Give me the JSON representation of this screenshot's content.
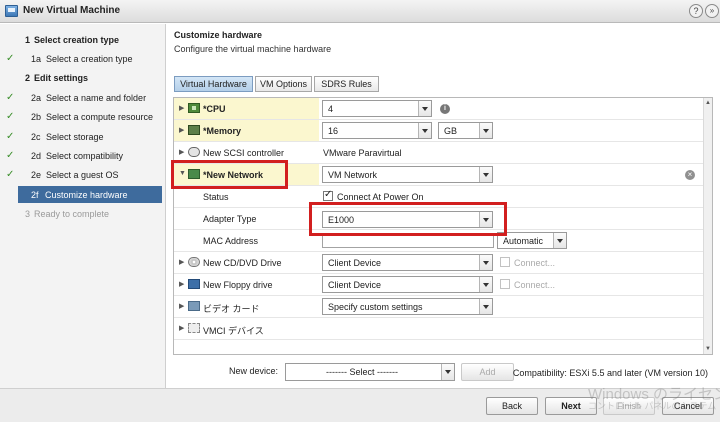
{
  "window": {
    "title": "New Virtual Machine",
    "help_label": "?",
    "expand_label": "»"
  },
  "wizard_steps": [
    {
      "num": "1",
      "label": "Select creation type",
      "kind": "header",
      "done": false
    },
    {
      "num": "1a",
      "label": "Select a creation type",
      "kind": "sub",
      "done": true
    },
    {
      "num": "2",
      "label": "Edit settings",
      "kind": "header",
      "done": false
    },
    {
      "num": "2a",
      "label": "Select a name and folder",
      "kind": "sub",
      "done": true
    },
    {
      "num": "2b",
      "label": "Select a compute resource",
      "kind": "sub",
      "done": true
    },
    {
      "num": "2c",
      "label": "Select storage",
      "kind": "sub",
      "done": true
    },
    {
      "num": "2d",
      "label": "Select compatibility",
      "kind": "sub",
      "done": true
    },
    {
      "num": "2e",
      "label": "Select a guest OS",
      "kind": "sub",
      "done": true
    },
    {
      "num": "2f",
      "label": "Customize hardware",
      "kind": "active",
      "done": false
    },
    {
      "num": "3",
      "label": "Ready to complete",
      "kind": "disabled",
      "done": false
    }
  ],
  "check_glyph": "✓",
  "main": {
    "title": "Customize hardware",
    "subtitle": "Configure the virtual machine hardware"
  },
  "tabs": [
    "Virtual Hardware",
    "VM Options",
    "SDRS Rules"
  ],
  "hardware": {
    "cpu": {
      "label": "*CPU",
      "value": "4"
    },
    "memory": {
      "label": "*Memory",
      "value": "16",
      "unit": "GB"
    },
    "scsi": {
      "label": "New SCSI controller",
      "value": "VMware Paravirtual"
    },
    "network": {
      "label": "*New Network",
      "value": "VM Network"
    },
    "status": {
      "label": "Status",
      "value": "Connect At Power On"
    },
    "adapter": {
      "label": "Adapter Type",
      "value": "E1000"
    },
    "mac": {
      "label": "MAC Address",
      "value": "",
      "mode": "Automatic"
    },
    "cd": {
      "label": "New CD/DVD Drive",
      "value": "Client Device",
      "connect": "Connect..."
    },
    "floppy": {
      "label": "New Floppy drive",
      "value": "Client Device",
      "connect": "Connect..."
    },
    "video": {
      "label": "ビデオ カード",
      "value": "Specify custom settings"
    },
    "vmci": {
      "label": "VMCI デバイス"
    }
  },
  "new_device": {
    "label": "New device:",
    "select": "------- Select -------",
    "add_label": "Add"
  },
  "compatibility": "Compatibility: ESXi 5.5 and later (VM version 10)",
  "buttons": {
    "back": "Back",
    "next": "Next",
    "finish": "Finish",
    "cancel": "Cancel"
  },
  "watermark": {
    "line1": "Windows のライセンス",
    "line2": "コントロール パネルのシステム"
  }
}
